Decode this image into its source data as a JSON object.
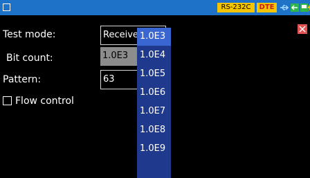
{
  "status_bar": {
    "rs_badge": "RS-232C",
    "dte_badge": "DTE",
    "icons": [
      "square-icon",
      "usb-icon",
      "connection-icon",
      "save-icon",
      "battery-icon"
    ],
    "colors": {
      "bar": "#1e72c8",
      "badge": "#f5c400",
      "dte_text": "#cc1a1a"
    }
  },
  "form": {
    "test_mode": {
      "label": "Test mode:",
      "value": "Receive bit"
    },
    "bit_count": {
      "label": "Bit count:",
      "value": "1.0E3"
    },
    "pattern": {
      "label": "Pattern:",
      "value": "63"
    },
    "flow_control": {
      "label": "Flow control",
      "checked": false
    }
  },
  "dropdown": {
    "options": [
      "1.0E3",
      "1.0E4",
      "1.0E5",
      "1.0E6",
      "1.0E7",
      "1.0E8",
      "1.0E9"
    ],
    "selected": "1.0E3",
    "colors": {
      "list": "#1f3a8c",
      "highlight": "#3a66d2"
    }
  }
}
